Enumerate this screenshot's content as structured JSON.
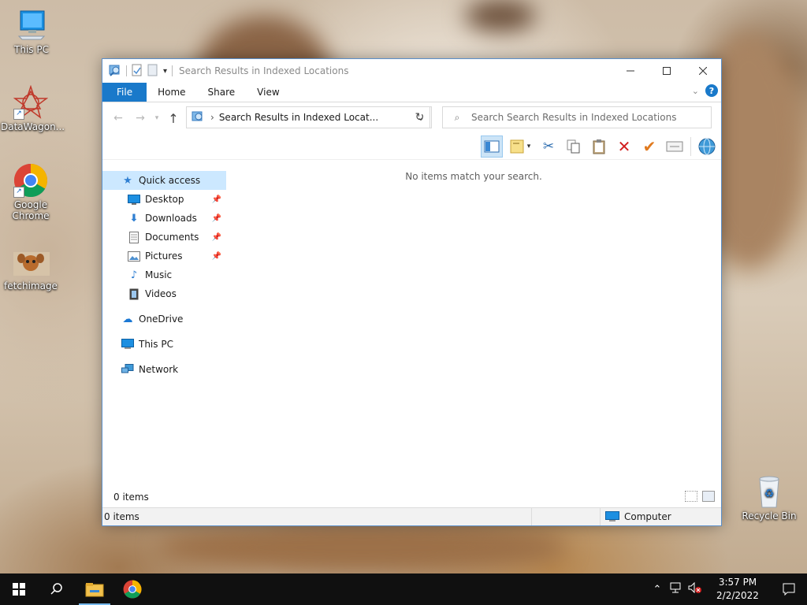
{
  "desktop": {
    "icons": [
      {
        "label": "This PC",
        "icon": "computer-icon"
      },
      {
        "label": "DataWagon...",
        "icon": "datawagon-icon"
      },
      {
        "label": "Google Chrome",
        "icon": "chrome-icon"
      },
      {
        "label": "fetchimage",
        "icon": "fetchimage-icon"
      },
      {
        "label": "Recycle Bin",
        "icon": "recycle-bin-icon"
      }
    ]
  },
  "window": {
    "title": "Search Results in Indexed Locations",
    "ribbon_tabs": [
      "File",
      "Home",
      "Share",
      "View"
    ],
    "address": "Search Results in Indexed Locat...",
    "search_placeholder": "Search Search Results in Indexed Locations",
    "empty_message": "No items match your search.",
    "item_count": "0 items",
    "status_count": "0 items",
    "status_location": "Computer",
    "accent_color": "#1979ca"
  },
  "sidebar": {
    "quick_access": "Quick access",
    "items": [
      {
        "label": "Desktop",
        "pinned": true
      },
      {
        "label": "Downloads",
        "pinned": true
      },
      {
        "label": "Documents",
        "pinned": true
      },
      {
        "label": "Pictures",
        "pinned": true
      },
      {
        "label": "Music",
        "pinned": false
      },
      {
        "label": "Videos",
        "pinned": false
      }
    ],
    "onedrive": "OneDrive",
    "this_pc": "This PC",
    "network": "Network"
  },
  "taskbar": {
    "time": "3:57 PM",
    "date": "2/2/2022"
  }
}
